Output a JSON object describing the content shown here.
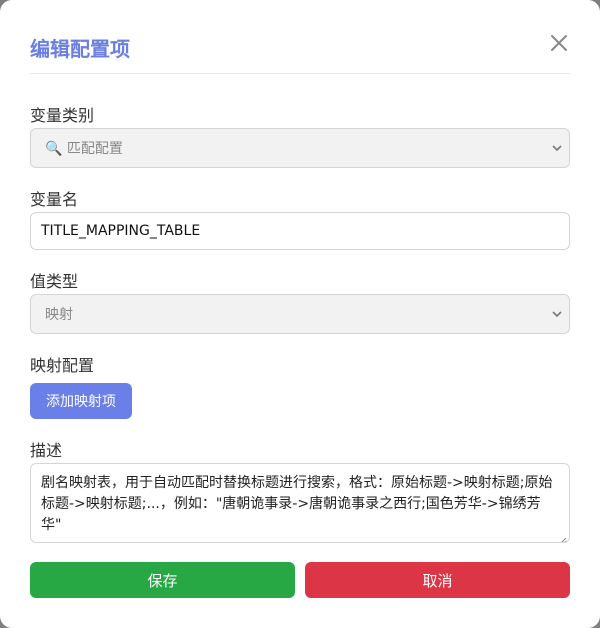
{
  "dialog": {
    "title": "编辑配置项"
  },
  "form": {
    "category": {
      "label": "变量类别",
      "value": "🔍 匹配配置"
    },
    "name": {
      "label": "变量名",
      "value": "TITLE_MAPPING_TABLE"
    },
    "value_type": {
      "label": "值类型",
      "value": "映射"
    },
    "mapping": {
      "label": "映射配置",
      "add_button": "添加映射项"
    },
    "description": {
      "label": "描述",
      "value": "剧名映射表，用于自动匹配时替换标题进行搜索，格式：原始标题->映射标题;原始标题->映射标题;...，例如：\"唐朝诡事录->唐朝诡事录之西行;国色芳华->锦绣芳华\""
    }
  },
  "actions": {
    "save": "保存",
    "cancel": "取消"
  },
  "colors": {
    "title": "#6b7fe0",
    "primary": "#6b7fe8",
    "save": "#28a745",
    "cancel": "#dc3545"
  }
}
